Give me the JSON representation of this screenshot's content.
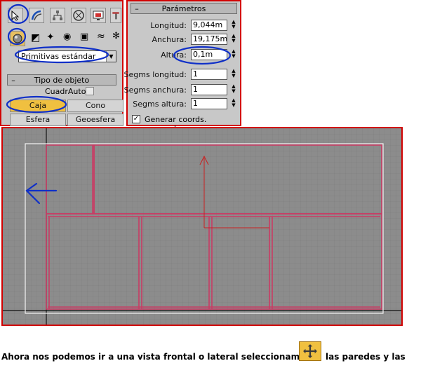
{
  "toolbar": {
    "icons": [
      "cursor-arrow-icon",
      "curve-icon",
      "hierarchy-icon",
      "circle-icon",
      "display-icon",
      "hammer-icon"
    ],
    "geometry_icons": [
      "sphere-icon",
      "lights-icon",
      "cameras-icon",
      "helpers-icon",
      "spacewarps-icon",
      "systems-icon"
    ]
  },
  "create_panel": {
    "dropdown_value": "Primitivas estándar",
    "rollout_title": "Tipo de objeto",
    "autogrid_label": "CuadrAuto",
    "buttons": [
      "Caja",
      "Cono",
      "Esfera",
      "Geoesfera"
    ]
  },
  "params_panel": {
    "rollout_title": "Parámetros",
    "fields": [
      {
        "label": "Longitud:",
        "value": "9,044m"
      },
      {
        "label": "Anchura:",
        "value": "19,175m"
      },
      {
        "label": "Altura:",
        "value": "0,1m"
      },
      {
        "label": "Segms longitud:",
        "value": "1"
      },
      {
        "label": "Segms anchura:",
        "value": "1"
      },
      {
        "label": "Segms altura:",
        "value": "1"
      }
    ],
    "checkbox_label": "Generar coords. mapeado",
    "checkbox_checked": true
  },
  "caption": {
    "text_before": "Ahora nos podemos ir a una vista frontal o lateral seleccionamos",
    "icon": "move-icon",
    "text_after": "las paredes y las"
  },
  "colors": {
    "frame": "#d20000",
    "wall": "#c83c64",
    "annotation": "#1030c8",
    "highlight": "#f0c040"
  }
}
